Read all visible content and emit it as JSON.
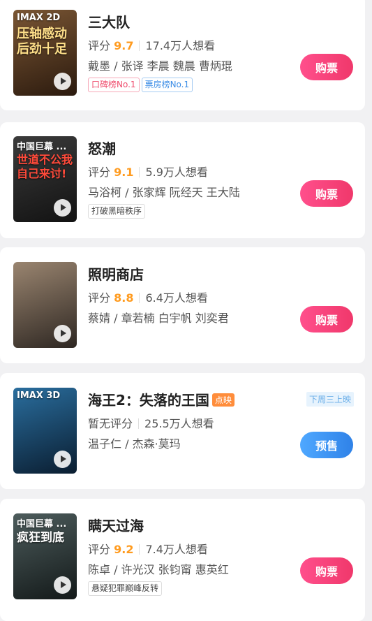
{
  "movies": [
    {
      "title": "三大队",
      "rating_label": "评分",
      "score": "9.7",
      "want": "17.4万人想看",
      "cast": "戴墨 / 张译 李晨 魏晨 曹炳琨",
      "tags": [
        "口碑榜No.1",
        "票房榜No.1"
      ],
      "poster_top": "IMAX 2D",
      "poster_main": "压轴感动后劲十足",
      "button": "购票",
      "poster_colors": [
        "#6a4a2a",
        "#2a1a10"
      ]
    },
    {
      "title": "怒潮",
      "rating_label": "评分",
      "score": "9.1",
      "want": "5.9万人想看",
      "cast": "马浴柯 / 张家辉 阮经天 王大陆",
      "tags": [
        "打破黑暗秩序"
      ],
      "poster_top": "中国巨幕 ...",
      "poster_main": "世道不公我自己来讨!",
      "button": "购票",
      "poster_colors": [
        "#3a3a3a",
        "#111111"
      ]
    },
    {
      "title": "照明商店",
      "rating_label": "评分",
      "score": "8.8",
      "want": "6.4万人想看",
      "cast": "蔡婧 / 章若楠 白宇帆 刘奕君",
      "tags": [],
      "poster_top": "",
      "poster_main": "",
      "button": "购票",
      "poster_colors": [
        "#8a7a6a",
        "#2f2a25"
      ]
    },
    {
      "title": "海王2：失落的王国",
      "badge": "点映",
      "no_rating": "暂无评分",
      "want": "25.5万人想看",
      "cast": "温子仁 / 杰森·莫玛",
      "tags": [],
      "release_note": "下周三上映",
      "poster_top": "IMAX 3D",
      "poster_main": "",
      "button": "预售",
      "poster_colors": [
        "#1d5a8a",
        "#0b1f33"
      ]
    },
    {
      "title": "瞒天过海",
      "rating_label": "评分",
      "score": "9.2",
      "want": "7.4万人想看",
      "cast": "陈卓 / 许光汉 张钧甯 惠英红",
      "tags": [
        "悬疑犯罪巅峰反转"
      ],
      "poster_top": "中国巨幕 ...",
      "poster_main": "疯狂到底",
      "button": "购票",
      "poster_colors": [
        "#4a5a5a",
        "#141a1a"
      ]
    }
  ]
}
